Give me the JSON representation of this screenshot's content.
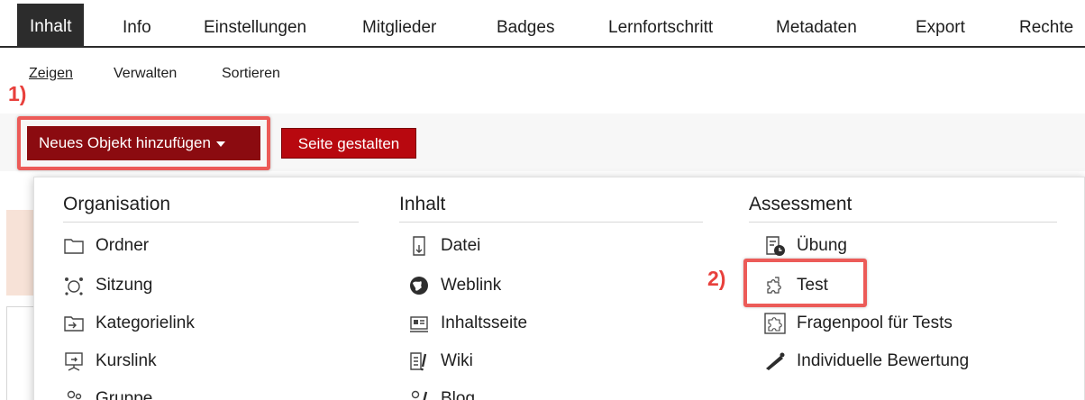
{
  "tabs": [
    {
      "label": "Inhalt",
      "active": true
    },
    {
      "label": "Info"
    },
    {
      "label": "Einstellungen"
    },
    {
      "label": "Mitglieder"
    },
    {
      "label": "Badges"
    },
    {
      "label": "Lernfortschritt"
    },
    {
      "label": "Metadaten"
    },
    {
      "label": "Export"
    },
    {
      "label": "Rechte"
    }
  ],
  "subtabs": [
    {
      "label": "Zeigen",
      "active": true
    },
    {
      "label": "Verwalten"
    },
    {
      "label": "Sortieren"
    }
  ],
  "toolbar": {
    "add_object_label": "Neues Objekt hinzufügen",
    "design_page_label": "Seite gestalten"
  },
  "annotations": {
    "step1": "1)",
    "step2": "2)"
  },
  "dropdown": {
    "columns": [
      {
        "heading": "Organisation",
        "items": [
          {
            "label": "Ordner",
            "icon": "folder-icon"
          },
          {
            "label": "Sitzung",
            "icon": "session-icon"
          },
          {
            "label": "Kategorielink",
            "icon": "category-link-icon"
          },
          {
            "label": "Kurslink",
            "icon": "course-link-icon"
          },
          {
            "label": "Gruppe",
            "icon": "group-icon"
          }
        ]
      },
      {
        "heading": "Inhalt",
        "items": [
          {
            "label": "Datei",
            "icon": "file-icon"
          },
          {
            "label": "Weblink",
            "icon": "weblink-icon"
          },
          {
            "label": "Inhaltsseite",
            "icon": "content-page-icon"
          },
          {
            "label": "Wiki",
            "icon": "wiki-icon"
          },
          {
            "label": "Blog",
            "icon": "blog-icon"
          }
        ]
      },
      {
        "heading": "Assessment",
        "items": [
          {
            "label": "Übung",
            "icon": "exercise-icon"
          },
          {
            "label": "Test",
            "icon": "test-puzzle-icon"
          },
          {
            "label": "Fragenpool für Tests",
            "icon": "question-pool-icon"
          },
          {
            "label": "Individuelle Bewertung",
            "icon": "individual-assessment-icon"
          }
        ]
      }
    ]
  },
  "colors": {
    "primary_button": "#8b0b10",
    "secondary_button": "#b8080f",
    "highlight": "#ec5b58",
    "tab_active": "#2c2c2c"
  }
}
